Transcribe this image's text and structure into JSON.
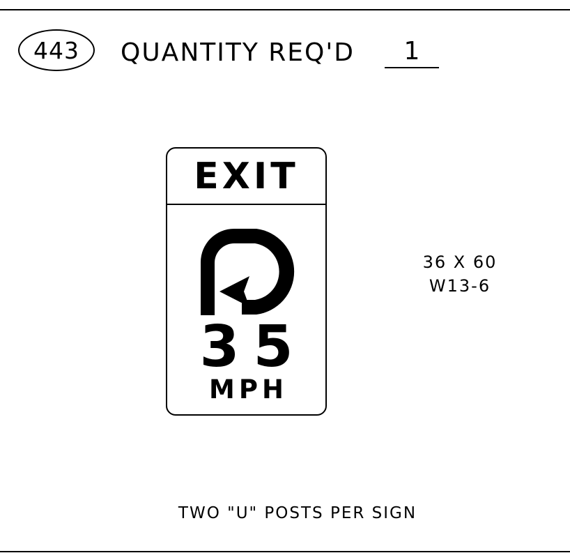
{
  "header": {
    "item_number": "443",
    "quantity_label": "QUANTITY REQ'D",
    "quantity_value": "1"
  },
  "sign": {
    "header_text": "EXIT",
    "symbol": "u-turn-arrow-icon",
    "speed_value": "35",
    "speed_unit": "MPH",
    "size": "36 X 60",
    "code": "W13-6"
  },
  "note": "TWO \"U\" POSTS PER SIGN"
}
